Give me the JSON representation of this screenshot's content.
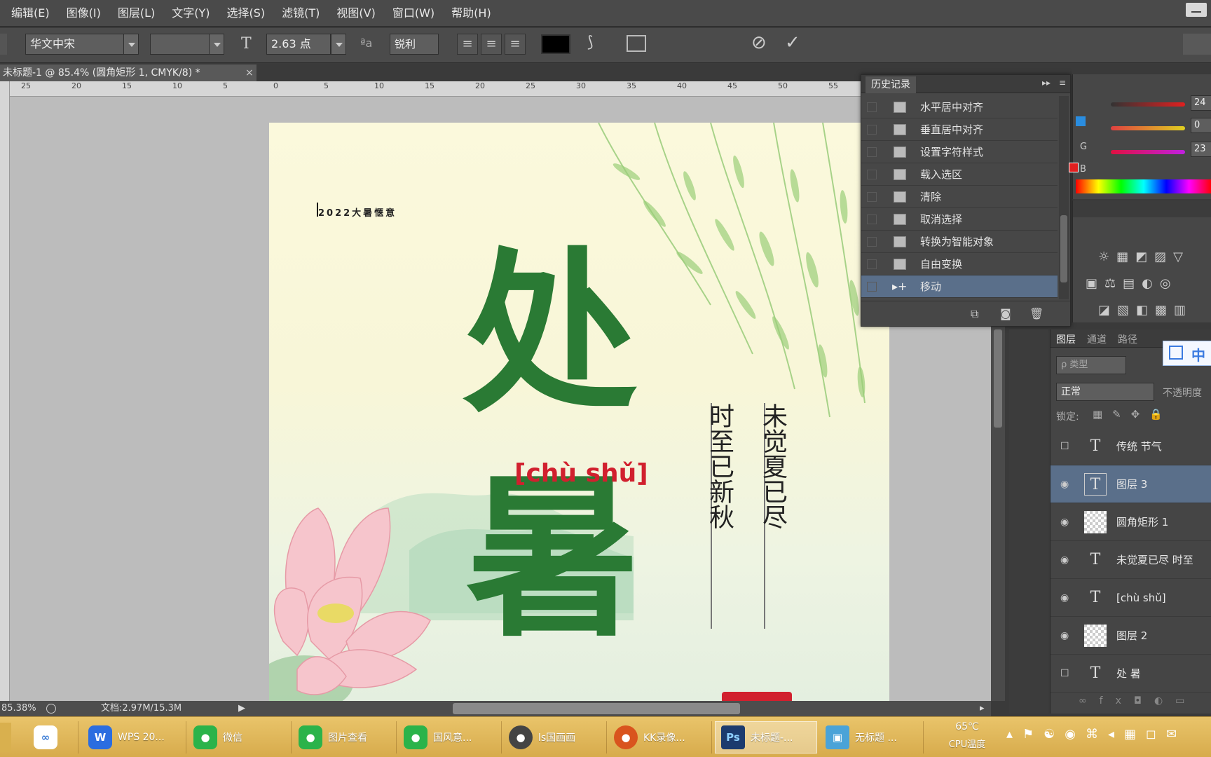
{
  "menu": [
    "编辑(E)",
    "图像(I)",
    "图层(L)",
    "文字(Y)",
    "选择(S)",
    "滤镜(T)",
    "视图(V)",
    "窗口(W)",
    "帮助(H)"
  ],
  "options": {
    "font_family": "华文中宋",
    "font_size": "2.63 点",
    "antialias": "锐利",
    "text_color": "#000000"
  },
  "document_tab": "未标题-1 @ 85.4% (圆角矩形 1, CMYK/8) *",
  "ruler_ticks": [
    "25",
    "20",
    "15",
    "10",
    "5",
    "0",
    "5",
    "10",
    "15",
    "20",
    "25",
    "30",
    "35",
    "40",
    "45",
    "50",
    "55"
  ],
  "canvas": {
    "small_caption": "2022大暑惬意",
    "big_char_top": "处",
    "big_char_bottom": "暑",
    "pinyin": "[chù  shǔ]",
    "poem_left": "时至已新秋",
    "poem_right": "未觉夏已尽"
  },
  "history": {
    "tab": "历史记录",
    "items": [
      "水平居中对齐",
      "垂直居中对齐",
      "设置字符样式",
      "载入选区",
      "清除",
      "取消选择",
      "转换为智能对象",
      "自由变换",
      "移动"
    ],
    "selected_index": 8
  },
  "color_panel": {
    "g_label": "G",
    "b_label": "B",
    "r_value": "24",
    "g_value": "0",
    "b_value": "23"
  },
  "layers": {
    "tabs": [
      "图层",
      "通道",
      "路径"
    ],
    "kind": "ρ 类型",
    "blend": "正常",
    "opacity_label": "不透明度",
    "lock_label": "锁定:",
    "items": [
      {
        "type": "T",
        "name": "传统 节气",
        "visible": false
      },
      {
        "type": "T",
        "name": "图层 3",
        "visible": true,
        "selected": true
      },
      {
        "type": "px",
        "name": "圆角矩形 1",
        "visible": true
      },
      {
        "type": "T",
        "name": "未觉夏已尽 时至",
        "visible": true
      },
      {
        "type": "T",
        "name": "[chù shǔ]",
        "visible": true
      },
      {
        "type": "px",
        "name": "图层 2",
        "visible": true
      },
      {
        "type": "T",
        "name": "处 暑",
        "visible": false
      }
    ]
  },
  "status": {
    "zoom": "85.38%",
    "doc": "文档:2.97M/15.3M"
  },
  "ime_badge": "中",
  "taskbar": {
    "items": [
      {
        "label": "",
        "color": "#3a7bd5",
        "icon": "∞"
      },
      {
        "label": "WPS 20...",
        "color": "#2b6de0",
        "icon": "W"
      },
      {
        "label": "微信",
        "color": "#2bb34a",
        "icon": "●"
      },
      {
        "label": "图片查看",
        "color": "#2bb34a",
        "icon": "●"
      },
      {
        "label": "国风意...",
        "color": "#2bb34a",
        "icon": "●"
      },
      {
        "label": "ls国画画",
        "color": "#444444",
        "icon": "●"
      },
      {
        "label": "KK录像...",
        "color": "#d9541e",
        "icon": "●"
      },
      {
        "label": "未标题-...",
        "color": "#1c3b6e",
        "icon": "Ps"
      },
      {
        "label": "无标题 ...",
        "color": "#4aa3d8",
        "icon": "▣"
      }
    ],
    "temp": "65℃",
    "temp_label": "CPU温度"
  }
}
